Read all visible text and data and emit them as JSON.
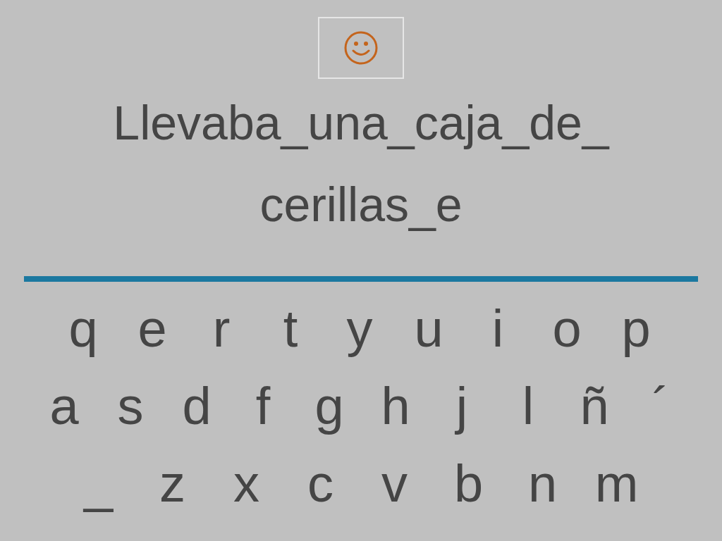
{
  "sentence_lines": [
    "Llevaba_una_caja_de_",
    "cerillas_e"
  ],
  "keyboard": {
    "rows": [
      [
        "q",
        "e",
        "r",
        "t",
        "y",
        "u",
        "i",
        "o",
        "p"
      ],
      [
        "a",
        "s",
        "d",
        "f",
        "g",
        "h",
        "j",
        "l",
        "ñ",
        "´"
      ],
      [
        "_",
        "z",
        "x",
        "c",
        "v",
        "b",
        "n",
        "m"
      ]
    ]
  }
}
